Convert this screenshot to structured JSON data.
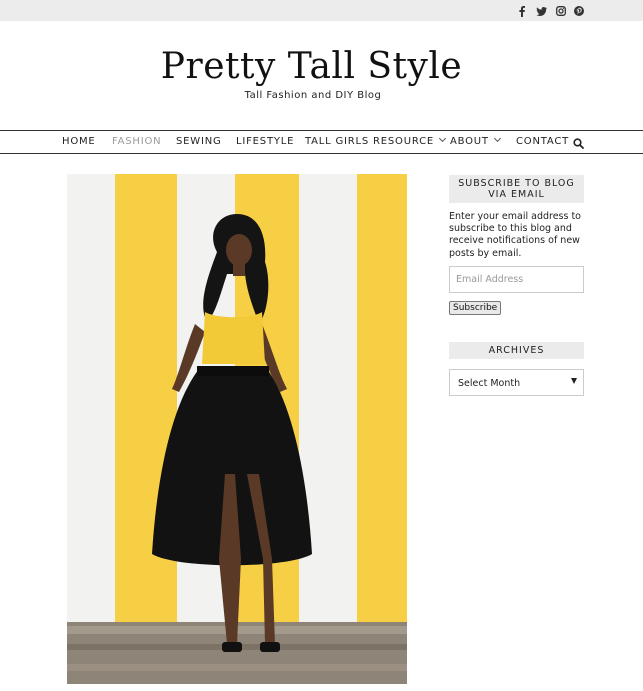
{
  "social": {
    "icons": [
      "facebook-icon",
      "twitter-icon",
      "instagram-icon",
      "pinterest-icon"
    ]
  },
  "header": {
    "title": "Pretty Tall Style",
    "tagline": "Tall Fashion and DIY Blog"
  },
  "nav": {
    "items": [
      {
        "label": "HOME"
      },
      {
        "label": "FASHION",
        "active": true
      },
      {
        "label": "SEWING"
      },
      {
        "label": "LIFESTYLE"
      },
      {
        "label": "TALL GIRLS RESOURCE",
        "has_dropdown": true
      },
      {
        "label": "ABOUT",
        "has_dropdown": true
      },
      {
        "label": "CONTACT"
      }
    ],
    "search_icon": "search-icon"
  },
  "colors": {
    "nav_active": "#9a9a9a",
    "widget_bg": "#ebebeb",
    "stripe_yellow": "#f7cf45"
  },
  "sidebar": {
    "subscribe": {
      "title": "SUBSCRIBE TO BLOG VIA EMAIL",
      "text": "Enter your email address to subscribe to this blog and receive notifications of new posts by email.",
      "email_placeholder": "Email Address",
      "button_label": "Subscribe"
    },
    "archives": {
      "title": "ARCHIVES",
      "selected": "Select Month"
    }
  }
}
